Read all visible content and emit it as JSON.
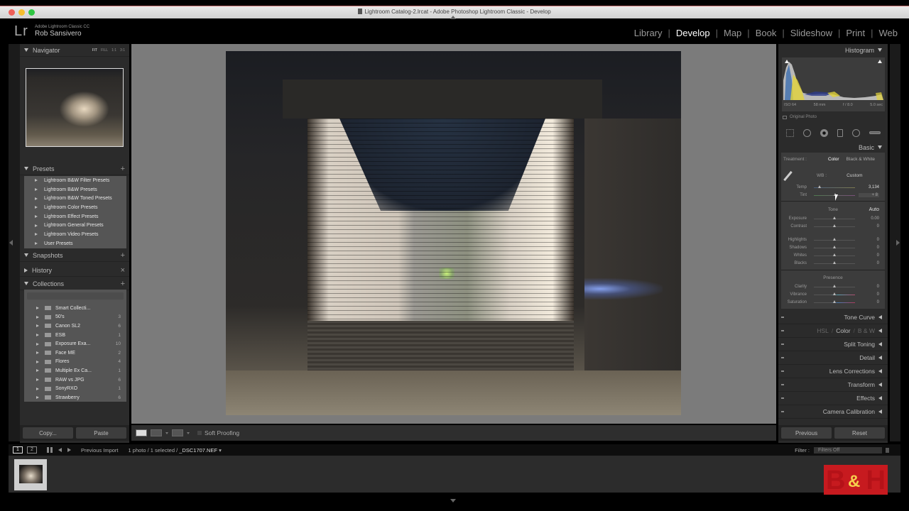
{
  "window": {
    "title": "Lightroom Catalog-2.lrcat - Adobe Photoshop Lightroom Classic - Develop"
  },
  "identity": {
    "logo": "Lr",
    "product": "Adobe Lightroom Classic CC",
    "user": "Rob Sansivero"
  },
  "modules": [
    {
      "label": "Library",
      "active": false
    },
    {
      "label": "Develop",
      "active": true
    },
    {
      "label": "Map",
      "active": false
    },
    {
      "label": "Book",
      "active": false
    },
    {
      "label": "Slideshow",
      "active": false
    },
    {
      "label": "Print",
      "active": false
    },
    {
      "label": "Web",
      "active": false
    }
  ],
  "left_panel": {
    "navigator": {
      "title": "Navigator",
      "zoom_options": [
        "FIT",
        "FILL",
        "1:1",
        "3:1"
      ]
    },
    "presets": {
      "title": "Presets",
      "add": "+",
      "items": [
        "Lightroom B&W Filter Presets",
        "Lightroom B&W Presets",
        "Lightroom B&W Toned Presets",
        "Lightroom Color Presets",
        "Lightroom Effect Presets",
        "Lightroom General Presets",
        "Lightroom Video Presets",
        "User Presets"
      ]
    },
    "snapshots": {
      "title": "Snapshots",
      "add": "+"
    },
    "history": {
      "title": "History",
      "clear": "×"
    },
    "collections": {
      "title": "Collections",
      "add": "+",
      "items": [
        {
          "name": "Smart Collecti...",
          "count": ""
        },
        {
          "name": "50's",
          "count": "3"
        },
        {
          "name": "Canon SL2",
          "count": "6"
        },
        {
          "name": "ESB",
          "count": "1"
        },
        {
          "name": "Exposure Exa...",
          "count": "10"
        },
        {
          "name": "Face ME",
          "count": "2"
        },
        {
          "name": "Flores",
          "count": "4"
        },
        {
          "name": "Multiple Ex Ca...",
          "count": "1"
        },
        {
          "name": "RAW vs JPG",
          "count": "6"
        },
        {
          "name": "SonyRXO",
          "count": "1"
        },
        {
          "name": "Strawberry",
          "count": "6"
        }
      ]
    },
    "buttons": {
      "copy": "Copy...",
      "paste": "Paste"
    }
  },
  "center": {
    "soft_proofing": "Soft Proofing"
  },
  "right_panel": {
    "histogram": {
      "title": "Histogram",
      "iso": "ISO 64",
      "focal": "58 mm",
      "aperture": "f / 8.0",
      "shutter": "5.0 sec",
      "original_photo": "Original Photo"
    },
    "basic": {
      "title": "Basic",
      "treatment_label": "Treatment :",
      "treatment_color": "Color",
      "treatment_bw": "Black & White",
      "wb_label": "WB :",
      "wb_value": "Custom",
      "temp": {
        "label": "Temp",
        "value": "3,134",
        "position": 0.15
      },
      "tint": {
        "label": "Tint",
        "value": "+ 8",
        "position": 0.53
      },
      "tone_label": "Tone",
      "auto_label": "Auto",
      "tone_sliders": [
        {
          "label": "Exposure",
          "value": "0.00",
          "position": 0.5
        },
        {
          "label": "Contrast",
          "value": "0",
          "position": 0.5
        }
      ],
      "light_sliders": [
        {
          "label": "Highlights",
          "value": "0",
          "position": 0.5
        },
        {
          "label": "Shadows",
          "value": "0",
          "position": 0.5
        },
        {
          "label": "Whites",
          "value": "0",
          "position": 0.5
        },
        {
          "label": "Blacks",
          "value": "0",
          "position": 0.5
        }
      ],
      "presence_label": "Presence",
      "presence_sliders": [
        {
          "label": "Clarity",
          "value": "0",
          "position": 0.5
        },
        {
          "label": "Vibrance",
          "value": "0",
          "position": 0.5
        },
        {
          "label": "Saturation",
          "value": "0",
          "position": 0.5
        }
      ]
    },
    "collapsed_panels": {
      "tone_curve": "Tone Curve",
      "hsl": "HSL",
      "color": "Color",
      "bw": "B & W",
      "split_toning": "Split Toning",
      "detail": "Detail",
      "lens_corrections": "Lens Corrections",
      "transform": "Transform",
      "effects": "Effects",
      "camera_calibration": "Camera Calibration"
    },
    "buttons": {
      "previous": "Previous",
      "reset": "Reset"
    }
  },
  "filmstrip": {
    "screen1": "1",
    "screen2": "2",
    "source": "Previous Import",
    "info_prefix": "1 photo / 1 selected /",
    "filename": "_DSC1707.NEF",
    "filter_label": "Filter :",
    "filter_value": "Filters Off"
  },
  "watermark": {
    "b": "B",
    "amp": "&",
    "h": "H"
  }
}
